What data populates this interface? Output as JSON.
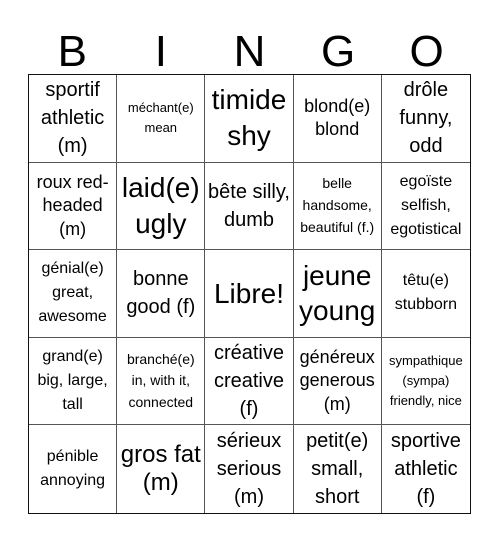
{
  "title_letters": [
    "B",
    "I",
    "N",
    "G",
    "O"
  ],
  "cells": [
    {
      "text": "sportif athletic (m)",
      "size": "s-m"
    },
    {
      "text": "méchant(e) mean",
      "size": "s-t"
    },
    {
      "text": "timide shy",
      "size": "s-xl"
    },
    {
      "text": "blond(e) blond",
      "size": "s-ms"
    },
    {
      "text": "drôle funny, odd",
      "size": "s-m"
    },
    {
      "text": "roux red-headed (m)",
      "size": "s-ms"
    },
    {
      "text": "laid(e) ugly",
      "size": "s-xl"
    },
    {
      "text": "bête silly, dumb",
      "size": "s-m"
    },
    {
      "text": "belle handsome, beautiful (f.)",
      "size": "s-xxs"
    },
    {
      "text": "egoïste selfish, egotistical",
      "size": "s-s"
    },
    {
      "text": "génial(e) great, awesome",
      "size": "s-s"
    },
    {
      "text": "bonne good (f)",
      "size": "s-m"
    },
    {
      "text": "Libre!",
      "size": "s-xl"
    },
    {
      "text": "jeune young",
      "size": "s-xl"
    },
    {
      "text": "têtu(e) stubborn",
      "size": "s-s"
    },
    {
      "text": "grand(e) big, large, tall",
      "size": "s-s"
    },
    {
      "text": "branché(e) in, with it, connected",
      "size": "s-xxs"
    },
    {
      "text": "créative creative (f)",
      "size": "s-m"
    },
    {
      "text": "généreux generous (m)",
      "size": "s-ms"
    },
    {
      "text": "sympathique (sympa) friendly, nice",
      "size": "s-t"
    },
    {
      "text": "pénible annoying",
      "size": "s-s"
    },
    {
      "text": "gros fat (m)",
      "size": "s-l"
    },
    {
      "text": "sérieux serious (m)",
      "size": "s-m"
    },
    {
      "text": "petit(e) small, short",
      "size": "s-m"
    },
    {
      "text": "sportive athletic (f)",
      "size": "s-m"
    }
  ]
}
